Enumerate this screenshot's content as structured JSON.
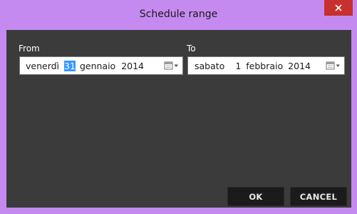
{
  "window": {
    "title": "Schedule range",
    "close_symbol": "×"
  },
  "from": {
    "label": "From",
    "weekday": "venerdì",
    "day": "31",
    "month": "gennaio",
    "year": "2014",
    "selected_segment": "day",
    "calendar_icon": "calendar-dropdown-icon"
  },
  "to": {
    "label": "To",
    "weekday": "sabato",
    "day": "1",
    "month": "febbraio",
    "year": "2014",
    "calendar_icon": "calendar-dropdown-icon"
  },
  "buttons": {
    "ok": "OK",
    "cancel": "CANCEL"
  },
  "colors": {
    "frame": "#c58af0",
    "client_bg": "#3b3b3b",
    "button_bg": "#1b1b1b",
    "close_bg": "#c7302c",
    "selection": "#3399ff"
  }
}
